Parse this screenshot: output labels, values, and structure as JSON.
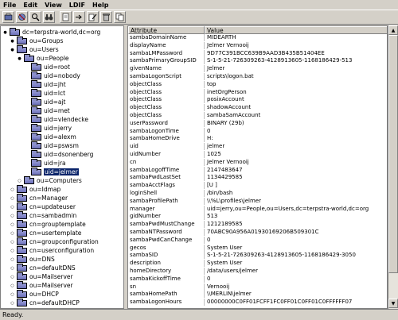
{
  "menu": [
    "File",
    "Edit",
    "View",
    "LDIF",
    "Help"
  ],
  "toolbar_icons": [
    "connect-icon",
    "disconnect-icon",
    "search-icon",
    "find-icon",
    "new-entry-icon",
    "edit-icon",
    "copy-icon",
    "delete-icon",
    "paste-icon"
  ],
  "tree": [
    {
      "label": "dc=terpstra-world,dc=org",
      "depth": 0,
      "toggle": "−",
      "selected": false
    },
    {
      "label": "ou=Groups",
      "depth": 1,
      "toggle": "−",
      "selected": false
    },
    {
      "label": "ou=Users",
      "depth": 1,
      "toggle": "−",
      "selected": false
    },
    {
      "label": "ou=People",
      "depth": 2,
      "toggle": "−",
      "selected": false
    },
    {
      "label": "uid=root",
      "depth": 3,
      "toggle": "",
      "selected": false
    },
    {
      "label": "uid=nobody",
      "depth": 3,
      "toggle": "",
      "selected": false
    },
    {
      "label": "uid=jht",
      "depth": 3,
      "toggle": "",
      "selected": false
    },
    {
      "label": "uid=lct",
      "depth": 3,
      "toggle": "",
      "selected": false
    },
    {
      "label": "uid=ajt",
      "depth": 3,
      "toggle": "",
      "selected": false
    },
    {
      "label": "uid=met",
      "depth": 3,
      "toggle": "",
      "selected": false
    },
    {
      "label": "uid=vlendecke",
      "depth": 3,
      "toggle": "",
      "selected": false
    },
    {
      "label": "uid=jerry",
      "depth": 3,
      "toggle": "",
      "selected": false
    },
    {
      "label": "uid=alexm",
      "depth": 3,
      "toggle": "",
      "selected": false
    },
    {
      "label": "uid=pswsm",
      "depth": 3,
      "toggle": "",
      "selected": false
    },
    {
      "label": "uid=dsonenberg",
      "depth": 3,
      "toggle": "",
      "selected": false
    },
    {
      "label": "uid=jra",
      "depth": 3,
      "toggle": "",
      "selected": false
    },
    {
      "label": "uid=jelmer",
      "depth": 3,
      "toggle": "",
      "selected": true
    },
    {
      "label": "ou=Computers",
      "depth": 2,
      "toggle": "+",
      "selected": false
    },
    {
      "label": "ou=Idmap",
      "depth": 1,
      "toggle": "+",
      "selected": false
    },
    {
      "label": "cn=Manager",
      "depth": 1,
      "toggle": "+",
      "selected": false
    },
    {
      "label": "cn=updateuser",
      "depth": 1,
      "toggle": "+",
      "selected": false
    },
    {
      "label": "cn=sambadmin",
      "depth": 1,
      "toggle": "+",
      "selected": false
    },
    {
      "label": "cn=grouptemplate",
      "depth": 1,
      "toggle": "+",
      "selected": false
    },
    {
      "label": "cn=usertemplate",
      "depth": 1,
      "toggle": "+",
      "selected": false
    },
    {
      "label": "cn=groupconfiguration",
      "depth": 1,
      "toggle": "+",
      "selected": false
    },
    {
      "label": "cn=userconfiguration",
      "depth": 1,
      "toggle": "+",
      "selected": false
    },
    {
      "label": "ou=DNS",
      "depth": 1,
      "toggle": "+",
      "selected": false
    },
    {
      "label": "cn=defaultDNS",
      "depth": 1,
      "toggle": "+",
      "selected": false
    },
    {
      "label": "ou=Mailserver",
      "depth": 1,
      "toggle": "+",
      "selected": false
    },
    {
      "label": "ou=Mailserver",
      "depth": 1,
      "toggle": "+",
      "selected": false
    },
    {
      "label": "ou=DHCP",
      "depth": 1,
      "toggle": "+",
      "selected": false
    },
    {
      "label": "cn=defaultDHCP",
      "depth": 1,
      "toggle": "+",
      "selected": false
    }
  ],
  "table": {
    "headers": [
      "Attribute",
      "Value"
    ],
    "rows": [
      [
        "sambaDomainName",
        "MIDEARTH"
      ],
      [
        "displayName",
        "Jelmer Vernooij"
      ],
      [
        "sambaLMPassword",
        "9D77C391BCC639B9AAD3B435B51404EE"
      ],
      [
        "sambaPrimaryGroupSID",
        "S-1-5-21-726309263-4128913605-1168186429-513"
      ],
      [
        "givenName",
        "Jelmer"
      ],
      [
        "sambaLogonScript",
        "scripts\\logon.bat"
      ],
      [
        "objectClass",
        "top"
      ],
      [
        "objectClass",
        "inetOrgPerson"
      ],
      [
        "objectClass",
        "posixAccount"
      ],
      [
        "objectClass",
        "shadowAccount"
      ],
      [
        "objectClass",
        "sambaSamAccount"
      ],
      [
        "userPassword",
        "BINARY (29b)"
      ],
      [
        "sambaLogonTime",
        "0"
      ],
      [
        "sambaHomeDrive",
        "H:"
      ],
      [
        "uid",
        "jelmer"
      ],
      [
        "uidNumber",
        "1025"
      ],
      [
        "cn",
        "Jelmer Vernooij"
      ],
      [
        "sambaLogoffTime",
        "2147483647"
      ],
      [
        "sambaPwdLastSet",
        "1134429585"
      ],
      [
        "sambaAcctFlags",
        "[U          ]"
      ],
      [
        "loginShell",
        "/bin/bash"
      ],
      [
        "sambaProfilePath",
        "\\\\%L\\profiles\\jelmer"
      ],
      [
        "manager",
        "uid=jerry,ou=People,ou=Users,dc=terpstra-world,dc=org"
      ],
      [
        "gidNumber",
        "513"
      ],
      [
        "sambaPwdMustChange",
        "1212189585"
      ],
      [
        "sambaNTPassword",
        "70ABC90A956A01930169206B509301C"
      ],
      [
        "sambaPwdCanChange",
        "0"
      ],
      [
        "gecos",
        "System User"
      ],
      [
        "sambaSID",
        "S-1-5-21-726309263-4128913605-1168186429-3050"
      ],
      [
        "description",
        "System User"
      ],
      [
        "homeDirectory",
        "/data/users/jelmer"
      ],
      [
        "sambaKickoffTime",
        "0"
      ],
      [
        "sn",
        "Vernooij"
      ],
      [
        "sambaHomePath",
        "\\\\MERLIN\\jelmer"
      ],
      [
        "sambaLogonHours",
        "00000000C0FF01FCFF1FC0FF01C0FF01C0FFFFFF07"
      ]
    ]
  },
  "status": "Ready."
}
